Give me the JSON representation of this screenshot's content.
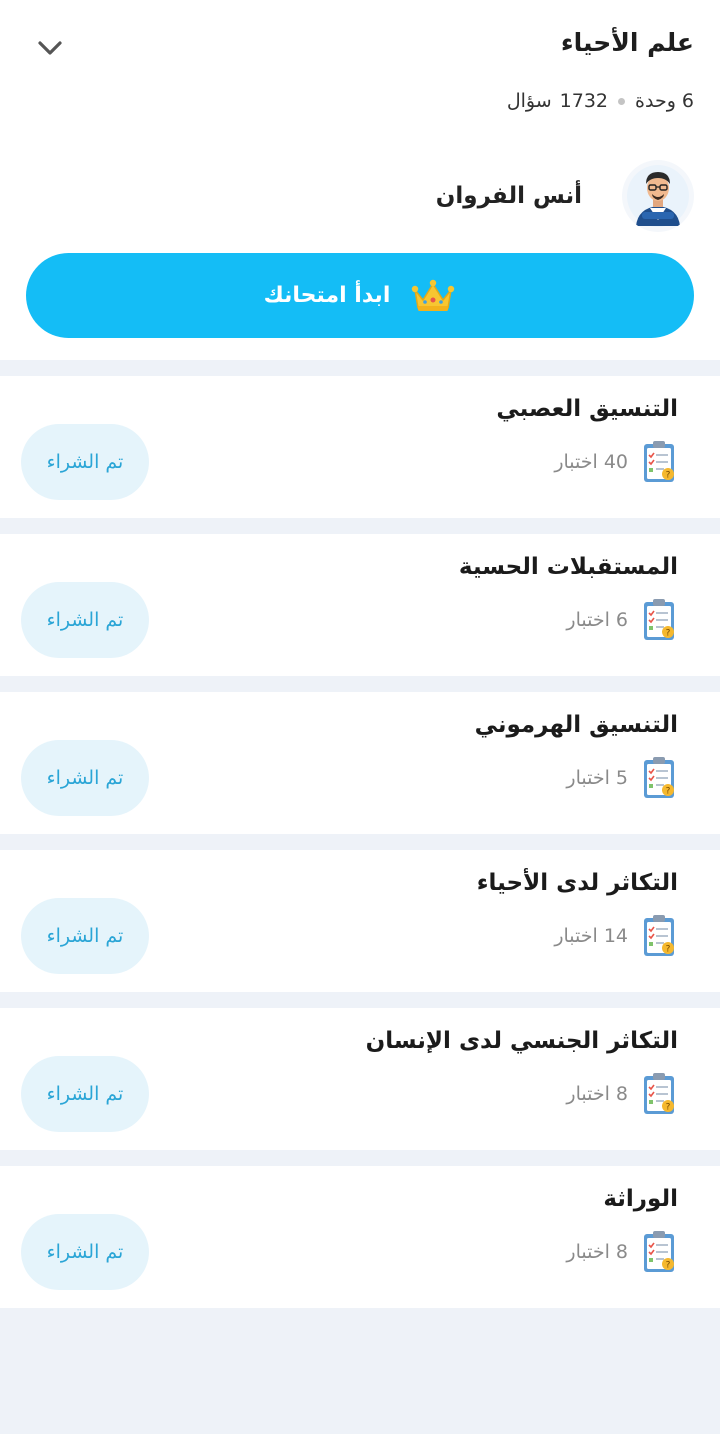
{
  "header": {
    "subject_title": "علم الأحياء",
    "units_count": "6 وحدة",
    "questions_count": "1732",
    "questions_label": "سؤال",
    "teacher_name": "أنس الفروان",
    "start_button_label": "ابدأ امتحانك"
  },
  "colors": {
    "accent": "#14bdf6",
    "purchased_bg": "#e5f4fb",
    "purchased_text": "#2aa5d6"
  },
  "icons": {
    "collapse": "chevron-down-icon",
    "start": "crown-icon",
    "quiz": "clipboard-checklist-icon"
  },
  "units": [
    {
      "title": "التنسيق العصبي",
      "tests": "40 اختبار",
      "status": "تم الشراء"
    },
    {
      "title": "المستقبلات الحسية",
      "tests": "6 اختبار",
      "status": "تم الشراء"
    },
    {
      "title": "التنسيق الهرموني",
      "tests": "5 اختبار",
      "status": "تم الشراء"
    },
    {
      "title": "التكاثر لدى الأحياء",
      "tests": "14 اختبار",
      "status": "تم الشراء"
    },
    {
      "title": "التكاثر الجنسي لدى الإنسان",
      "tests": "8 اختبار",
      "status": "تم الشراء"
    },
    {
      "title": "الوراثة",
      "tests": "8 اختبار",
      "status": "تم الشراء"
    }
  ]
}
